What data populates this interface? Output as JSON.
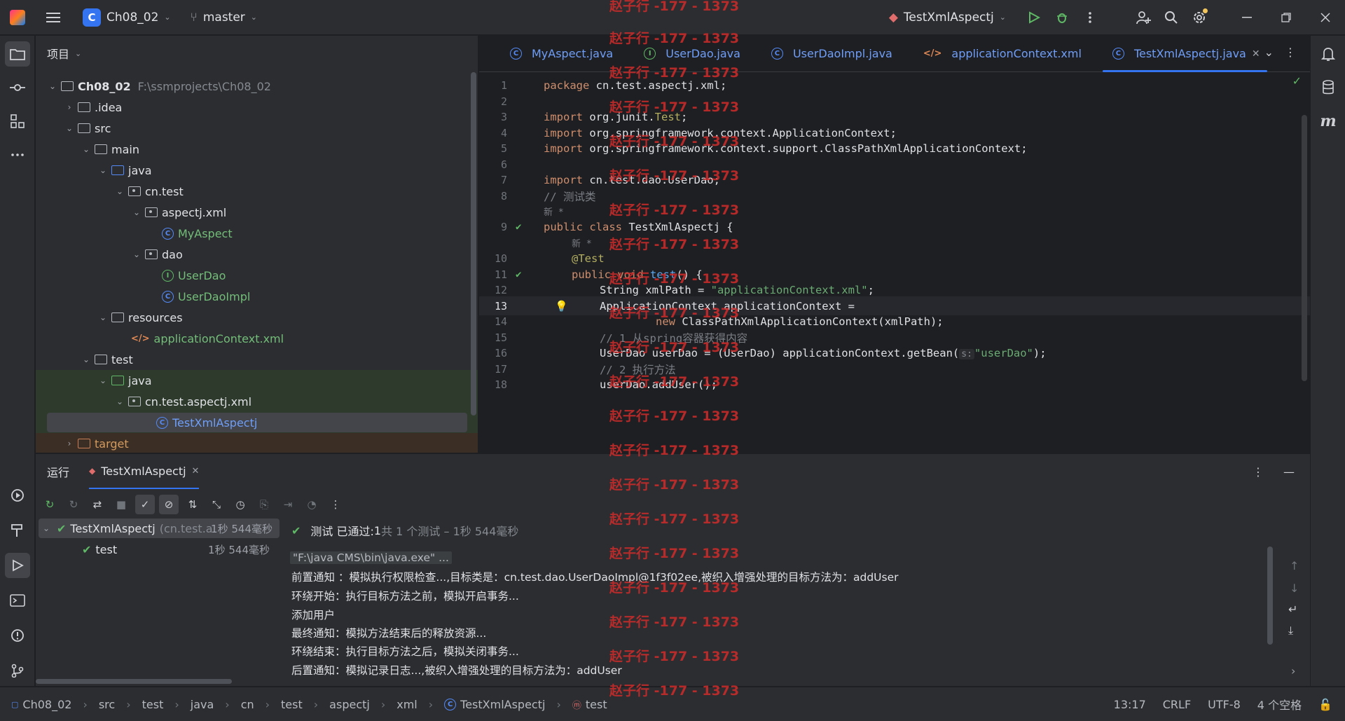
{
  "titlebar": {
    "project_badge": "C",
    "project_name": "Ch08_02",
    "branch": "master",
    "run_config": "TestXmlAspectj"
  },
  "project_panel": {
    "title": "项目",
    "tree": [
      {
        "label": "Ch08_02",
        "path": "F:\\ssmprojects\\Ch08_02"
      },
      {
        "label": ".idea"
      },
      {
        "label": "src"
      },
      {
        "label": "main"
      },
      {
        "label": "java"
      },
      {
        "label": "cn.test"
      },
      {
        "label": "aspectj.xml"
      },
      {
        "label": "MyAspect"
      },
      {
        "label": "dao"
      },
      {
        "label": "UserDao"
      },
      {
        "label": "UserDaoImpl"
      },
      {
        "label": "resources"
      },
      {
        "label": "applicationContext.xml"
      },
      {
        "label": "test"
      },
      {
        "label": "java"
      },
      {
        "label": "cn.test.aspectj.xml"
      },
      {
        "label": "TestXmlAspectj"
      },
      {
        "label": "target"
      }
    ]
  },
  "editor": {
    "tabs": [
      {
        "label": "MyAspect.java"
      },
      {
        "label": "UserDao.java"
      },
      {
        "label": "UserDaoImpl.java"
      },
      {
        "label": "applicationContext.xml"
      },
      {
        "label": "TestXmlAspectj.java"
      }
    ],
    "lines": [
      {
        "n": "1"
      },
      {
        "n": "2"
      },
      {
        "n": "3"
      },
      {
        "n": "4"
      },
      {
        "n": "5"
      },
      {
        "n": "6"
      },
      {
        "n": "7"
      },
      {
        "n": "8"
      },
      {
        "n": ""
      },
      {
        "n": "9"
      },
      {
        "n": ""
      },
      {
        "n": "10"
      },
      {
        "n": "11"
      },
      {
        "n": "12"
      },
      {
        "n": "13"
      },
      {
        "n": "14"
      },
      {
        "n": "15"
      },
      {
        "n": "16"
      },
      {
        "n": "17"
      },
      {
        "n": "18"
      }
    ],
    "code": {
      "l1a": "package",
      "l1b": " cn.test.aspectj.xml;",
      "l3a": "import",
      "l3b": " org.junit.",
      "l3c": "Test",
      "l3d": ";",
      "l4a": "import",
      "l4b": " org.springframework.context.ApplicationContext;",
      "l5a": "import",
      "l5b": " org.springframework.context.support.ClassPathXmlApplicationContext;",
      "l7a": "import",
      "l7b": " cn.test.dao.UserDao;",
      "l8": "// 测试类",
      "new_hint": "新 *",
      "l9a": "public class",
      "l9b": " TestXmlAspectj {",
      "l10": "@Test",
      "l11a": "public void",
      "l11b": " ",
      "l11c": "test",
      "l11d": "() {",
      "l12a": "String xmlPath = ",
      "l12b": "\"applicationContext.xml\"",
      "l12c": ";",
      "l13": "ApplicationContext applicationContext =",
      "l14a": "new",
      "l14b": " ClassPathXmlApplicationContext(xmlPath);",
      "l15": "// 1 从spring容器获得内容",
      "l16a": "UserDao userDao = (UserDao) applicationContext.getBean(",
      "l16hint": "s:",
      "l16b": "\"userDao\"",
      "l16c": ");",
      "l17": "// 2 执行方法",
      "l18": "userDao.addUser();"
    }
  },
  "run_panel": {
    "title": "运行",
    "tab": "TestXmlAspectj",
    "tests": [
      {
        "name": "TestXmlAspectj",
        "pkg": "(cn.test.a",
        "time": "1秒 544毫秒"
      },
      {
        "name": "test",
        "time": "1秒 544毫秒"
      }
    ],
    "status_prefix": "测试 已通过: ",
    "status_count": "1",
    "status_suffix": "共 1 个测试 – 1秒 544毫秒",
    "console": [
      "\"F:\\java CMS\\bin\\java.exe\" ...",
      "前置通知 ：模拟执行权限检查...,目标类是：cn.test.dao.UserDaoImpl@1f3f02ee,被织入增强处理的目标方法为：addUser",
      "环绕开始：执行目标方法之前，模拟开启事务...",
      "添加用户",
      "最终通知：模拟方法结束后的释放资源...",
      "环绕结束：执行目标方法之后，模拟关闭事务...",
      "后置通知：模拟记录日志...,被织入增强处理的目标方法为：addUser"
    ]
  },
  "statusbar": {
    "crumbs": [
      "Ch08_02",
      "src",
      "test",
      "java",
      "cn",
      "test",
      "aspectj",
      "xml",
      "TestXmlAspectj",
      "test"
    ],
    "position": "13:17",
    "line_sep": "CRLF",
    "encoding": "UTF-8",
    "indent": "4 个空格"
  },
  "watermark": "赵子行 -177 - 1373",
  "colors": {
    "accent": "#3574f0",
    "pass": "#5fb865",
    "watermark": "#d12b2b"
  }
}
